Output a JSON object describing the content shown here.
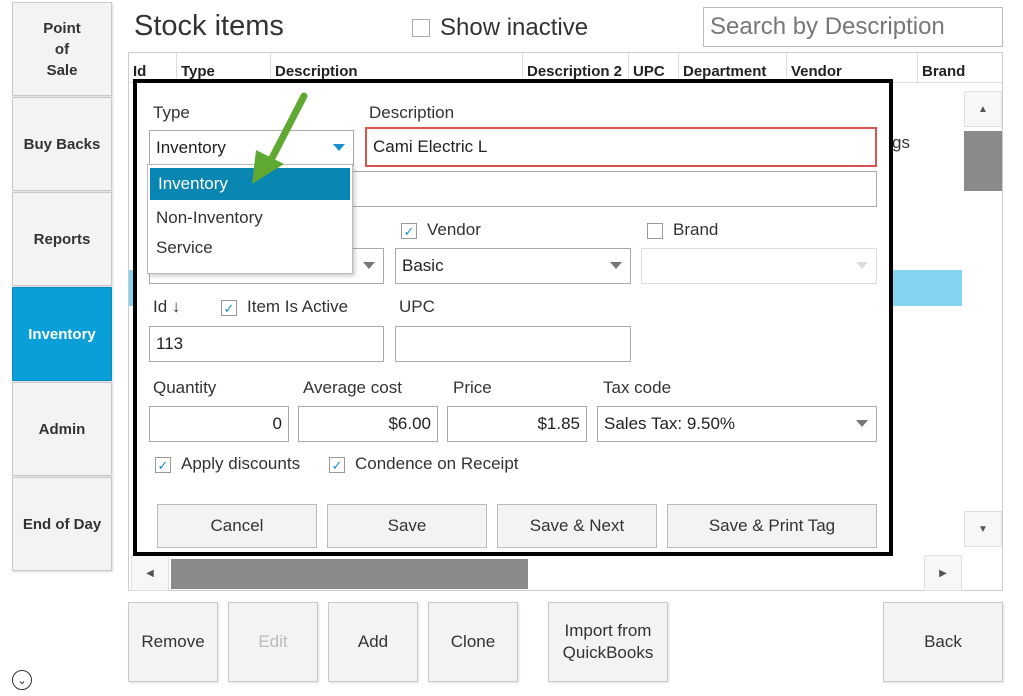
{
  "sidebar": {
    "items": [
      {
        "label": "Point\nof\nSale"
      },
      {
        "label": "Buy Backs"
      },
      {
        "label": "Reports"
      },
      {
        "label": "Inventory"
      },
      {
        "label": "Admin"
      },
      {
        "label": "End of Day"
      }
    ]
  },
  "header": {
    "title": "Stock items",
    "show_inactive_label": "Show inactive",
    "search_placeholder": "Search by Description"
  },
  "grid": {
    "columns": [
      "Id",
      "Type",
      "Description",
      "Description 2",
      "UPC",
      "Department",
      "Vendor",
      "Brand"
    ],
    "partial_text": "gs"
  },
  "dialog": {
    "type_label": "Type",
    "type_value": "Inventory",
    "type_options": [
      "Inventory",
      "Non-Inventory",
      "Service"
    ],
    "description_label": "Description",
    "description_value": "Cami Electric L",
    "description2_value": "",
    "vendor_label": "Vendor",
    "vendor_value": "Basic",
    "vendor_checked": true,
    "brand_label": "Brand",
    "brand_checked": false,
    "id_label": "Id ↓",
    "id_value": "113",
    "active_label": "Item Is Active",
    "active_checked": true,
    "upc_label": "UPC",
    "upc_value": "",
    "quantity_label": "Quantity",
    "quantity_value": "0",
    "avg_cost_label": "Average cost",
    "avg_cost_value": "$6.00",
    "price_label": "Price",
    "price_value": "$1.85",
    "tax_label": "Tax code",
    "tax_value": "Sales Tax: 9.50%",
    "apply_discounts_label": "Apply discounts",
    "apply_discounts_checked": true,
    "condense_label": "Condence on Receipt",
    "condense_checked": true,
    "buttons": {
      "cancel": "Cancel",
      "save": "Save",
      "save_next": "Save & Next",
      "save_print": "Save & Print Tag"
    }
  },
  "bottom_buttons": {
    "remove": "Remove",
    "edit": "Edit",
    "add": "Add",
    "clone": "Clone",
    "import": "Import from\nQuickBooks",
    "back": "Back"
  },
  "icons": {
    "check": "✓",
    "scroll_up": "▲",
    "scroll_down": "▼",
    "scroll_left": "◀",
    "scroll_right": "▶",
    "expand": "⌄"
  },
  "colors": {
    "accent": "#0a9fd8",
    "selected_row": "#82d4ef",
    "annotation_arrow": "#5fa832",
    "focus_border": "#d9534f"
  }
}
